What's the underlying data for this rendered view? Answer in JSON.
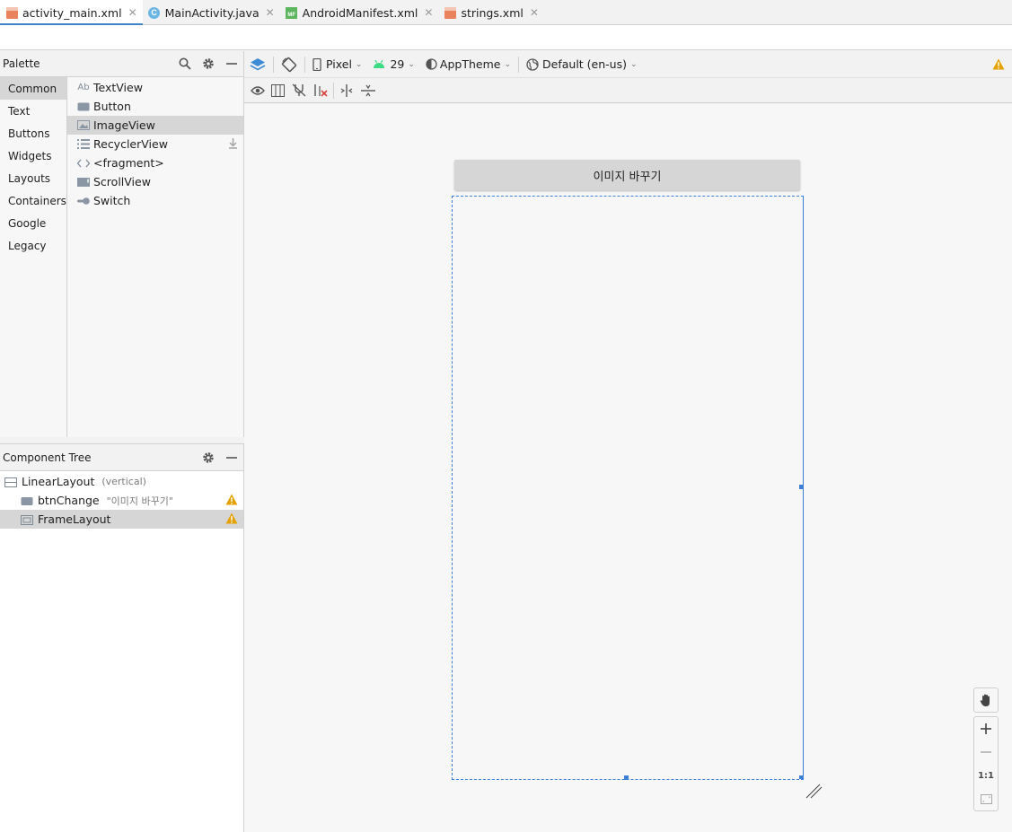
{
  "tabs": [
    {
      "label": "activity_main.xml",
      "icon": "xml-file-icon",
      "active": true
    },
    {
      "label": "MainActivity.java",
      "icon": "java-class-icon",
      "active": false
    },
    {
      "label": "AndroidManifest.xml",
      "icon": "manifest-file-icon",
      "active": false
    },
    {
      "label": "strings.xml",
      "icon": "xml-file-icon",
      "active": false
    }
  ],
  "palette": {
    "title": "Palette",
    "categories": [
      "Common",
      "Text",
      "Buttons",
      "Widgets",
      "Layouts",
      "Containers",
      "Google",
      "Legacy"
    ],
    "selected_category": "Common",
    "widgets": [
      {
        "label": "TextView",
        "icon_text": "Ab"
      },
      {
        "label": "Button"
      },
      {
        "label": "ImageView"
      },
      {
        "label": "RecyclerView"
      },
      {
        "label": "<fragment>",
        "icon_text": "<>"
      },
      {
        "label": "ScrollView"
      },
      {
        "label": "Switch"
      }
    ],
    "selected_widget": "ImageView"
  },
  "component_tree": {
    "title": "Component Tree",
    "nodes": [
      {
        "label": "LinearLayout",
        "sub": "(vertical)"
      },
      {
        "label": "btnChange",
        "sub": "\"이미지 바꾸기\""
      },
      {
        "label": "FrameLayout",
        "sub": ""
      }
    ]
  },
  "toolbar": {
    "device": "Pixel",
    "api": "29",
    "theme": "AppTheme",
    "locale": "Default (en-us)"
  },
  "design": {
    "button_text": "이미지 바꾸기"
  },
  "zoom": {
    "one_to_one": "1:1"
  },
  "colors": {
    "accent": "#3d7fd4",
    "warning": "#e5a100",
    "selection": "#d6d6d6"
  }
}
